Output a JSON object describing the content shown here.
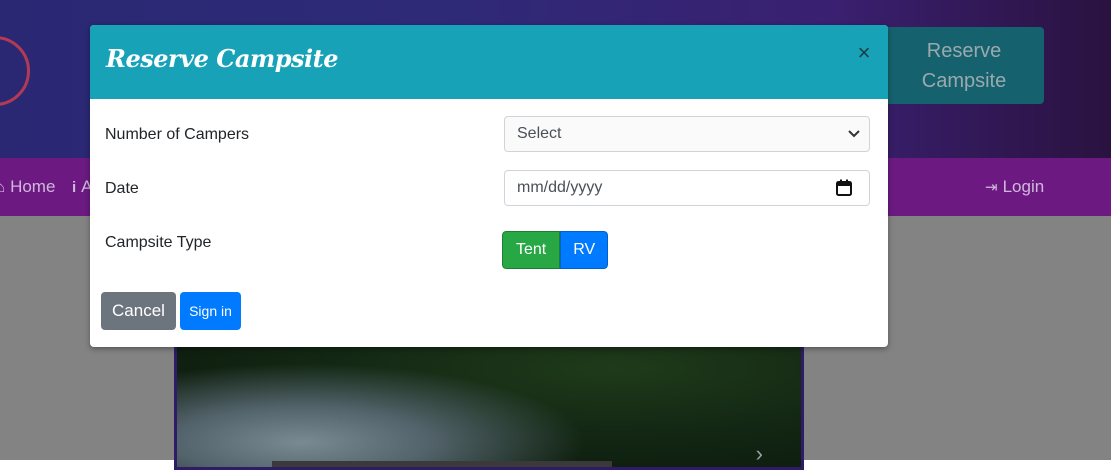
{
  "header": {
    "cta_label": "Reserve\nCampsite"
  },
  "nav": {
    "home_label": "Home",
    "about_label": "A",
    "login_label": "Login"
  },
  "modal": {
    "title": "Reserve Campsite",
    "close_label": "×",
    "campers": {
      "label": "Number of Campers",
      "selected": "Select"
    },
    "date": {
      "label": "Date",
      "placeholder": "mm/dd/yyyy"
    },
    "campsite_type": {
      "label": "Campsite Type",
      "options": [
        "Tent",
        "RV"
      ]
    },
    "cancel_label": "Cancel",
    "submit_label": "Sign in"
  },
  "colors": {
    "modal_header": "#17a2b8",
    "tent_button": "#28a745",
    "rv_button": "#007bff",
    "cancel_button": "#6c757d",
    "submit_button": "#007bff",
    "navbar": "#6c1a82"
  },
  "icons": {
    "home": "home-icon",
    "about": "info-icon",
    "login": "sign-in-icon",
    "calendar": "calendar-icon",
    "select_arrow": "chevron-down-icon",
    "carousel_next": "chevron-right-icon"
  }
}
